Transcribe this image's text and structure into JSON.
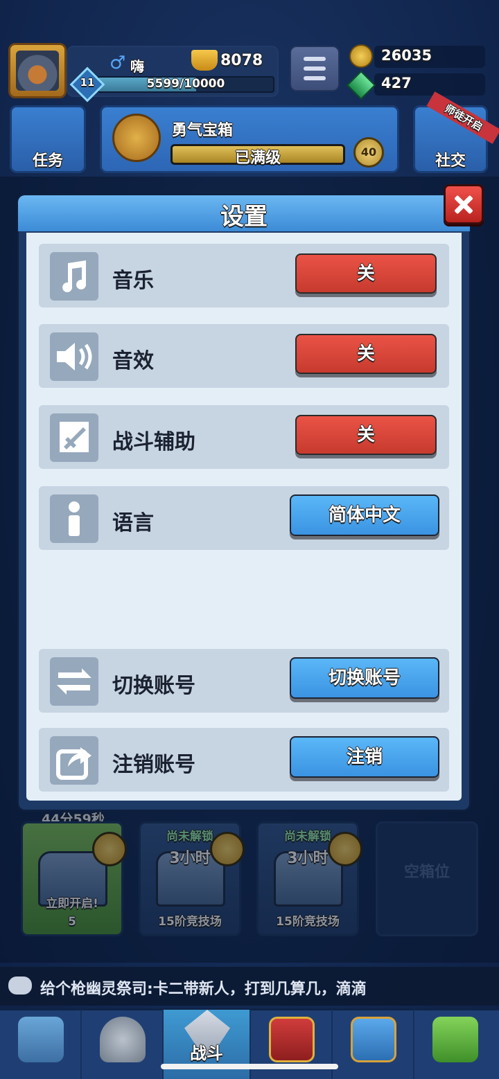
{
  "player": {
    "name": "嗨",
    "trophies": "8078",
    "level": "11",
    "xp_text": "5599/10000",
    "xp_progress": 0.56
  },
  "currency": {
    "coins": "26035",
    "gems": "427"
  },
  "top_buttons": {
    "task_label": "任务",
    "social_label": "社交",
    "social_ribbon": "师徒开启"
  },
  "courage_chest": {
    "title": "勇气宝箱",
    "status": "已满级",
    "level": "40"
  },
  "settings_modal": {
    "title": "设置",
    "rows": [
      {
        "label": "音乐",
        "button": "关",
        "icon": "music-note-icon"
      },
      {
        "label": "音效",
        "button": "关",
        "icon": "speaker-icon"
      },
      {
        "label": "战斗辅助",
        "button": "关",
        "icon": "sword-icon"
      },
      {
        "label": "语言",
        "button": "简体中文",
        "icon": "info-icon"
      },
      {
        "label": "切换账号",
        "button": "切换账号",
        "icon": "swap-arrows-icon"
      },
      {
        "label": "注销账号",
        "button": "注销",
        "icon": "share-export-icon"
      }
    ]
  },
  "chests": {
    "timer": "44分59秒",
    "slot1_open_label": "立即开启!",
    "slot1_cost": "5",
    "locked_label": "尚未解锁",
    "locked_time": "3小时",
    "arena_label": "15阶竞技场",
    "empty_label": "空箱位"
  },
  "chat": {
    "message": "给个枪幽灵祭司:卡二带新人，打到几算几，滴滴"
  },
  "nav": {
    "battle_label": "战斗"
  },
  "colors": {
    "off_button": "#d94a3c",
    "blue_button": "#4aa6ee",
    "modal_header": "#55a6e6",
    "modal_body": "#e4eef6"
  }
}
